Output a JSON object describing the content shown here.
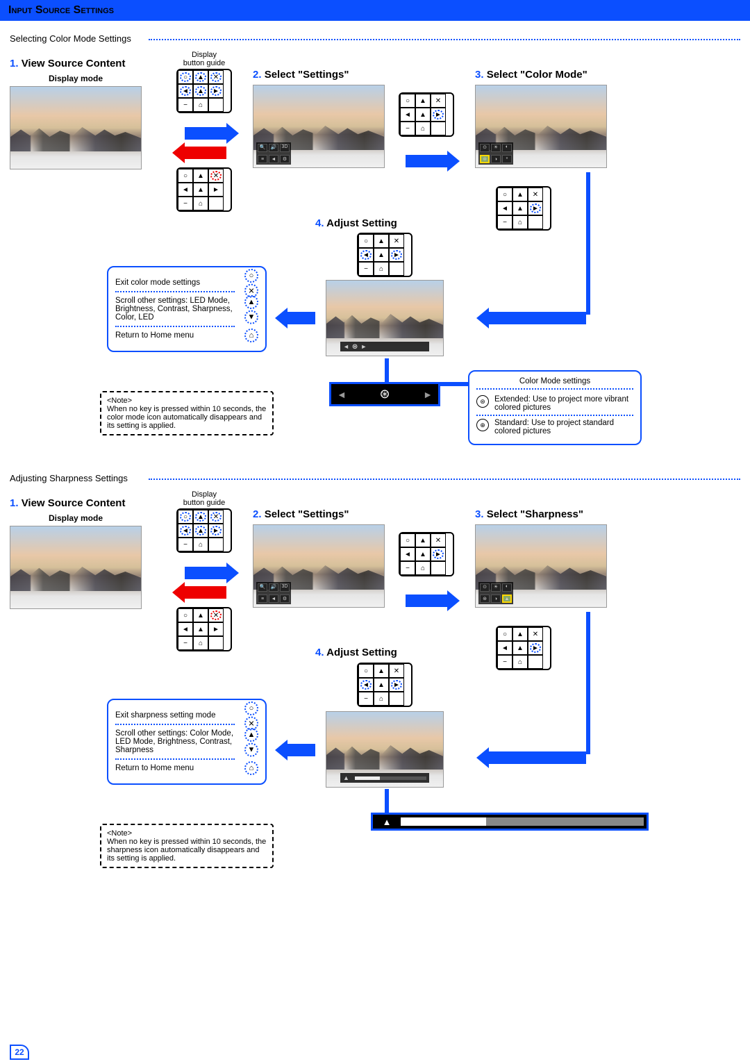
{
  "header": "Input Source Settings",
  "page_number": "22",
  "section1": {
    "title": "Selecting Color Mode Settings",
    "step1": {
      "title": "View Source Content",
      "display_mode": "Display mode",
      "guide_label": "Display\nbutton guide"
    },
    "step2": {
      "title": "Select \"Settings\""
    },
    "step3": {
      "title": "Select \"Color Mode\""
    },
    "step4": {
      "title": "Adjust Setting"
    },
    "legend": {
      "exit": "Exit color mode settings",
      "scroll": "Scroll other settings: LED Mode, Brightness, Contrast, Sharpness, Color, LED",
      "home": "Return to Home menu"
    },
    "note": {
      "label": "<Note>",
      "text": "When no key is pressed within 10 seconds, the color mode icon automatically disappears and its setting is applied."
    },
    "cm_settings": {
      "title": "Color Mode settings",
      "ext": "Extended: Use to project more vibrant colored pictures",
      "std": "Standard: Use to project standard colored pictures"
    }
  },
  "section2": {
    "title": "Adjusting Sharpness Settings",
    "step1": {
      "title": "View Source Content",
      "display_mode": "Display mode",
      "guide_label": "Display\nbutton guide"
    },
    "step2": {
      "title": "Select \"Settings\""
    },
    "step3": {
      "title": "Select \"Sharpness\""
    },
    "step4": {
      "title": "Adjust Setting"
    },
    "legend": {
      "exit": "Exit sharpness setting mode",
      "scroll": "Scroll other settings: Color Mode, LED Mode, Brightness, Contrast, Sharpness",
      "home": "Return to Home menu"
    },
    "note": {
      "label": "<Note>",
      "text": "When no key is pressed within 10 seconds, the sharpness icon automatically disappears and its setting is applied."
    }
  },
  "step_numbers": {
    "n1": "1.",
    "n2": "2.",
    "n3": "3.",
    "n4": "4."
  }
}
